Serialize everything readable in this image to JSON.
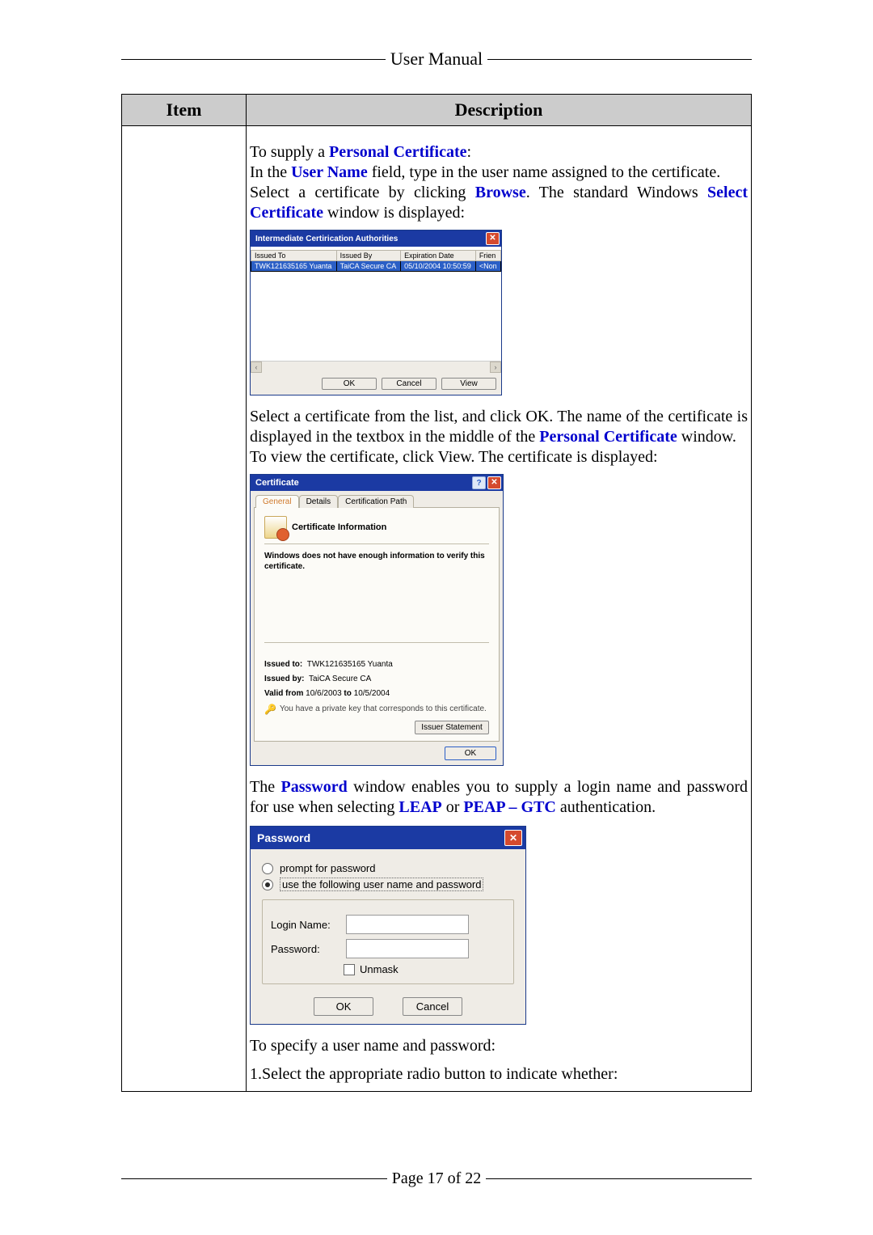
{
  "header": {
    "user_manual": "User Manual"
  },
  "table": {
    "item_header": "Item",
    "desc_header": "Description"
  },
  "content": {
    "supply_prefix": "To supply a ",
    "supply_bold": "Personal Certificate",
    "supply_suffix": ":",
    "username_prefix": "In the ",
    "username_bold": "User Name",
    "username_suffix": " field, type in the user name assigned to the certificate.",
    "select_prefix": "Select a certificate by clicking ",
    "select_browse": "Browse",
    "select_mid": ". The standard Windows ",
    "select_bold": "Select Certificate",
    "select_suffix": " window is displayed:",
    "after_list_prefix": "Select a certificate from the list, and click OK. The name of the certificate is displayed in the textbox in the middle of the ",
    "after_list_bold": "Personal Certificate",
    "after_list_suffix": " window.",
    "view_line": "To view the certificate, click View. The certificate is displayed:",
    "pw_prefix": "The ",
    "pw_bold": "Password",
    "pw_mid": " window enables you to supply a login name and password for use when selecting ",
    "pw_leap": "LEAP",
    "pw_or": " or ",
    "pw_peap": "PEAP – GTC",
    "pw_suffix": " authentication.",
    "spec_line": "To specify a user name and password:",
    "step1": "1.Select the appropriate radio button to indicate whether:"
  },
  "dlg1": {
    "title": "Intermediate Certirication Authorities",
    "col_issued_to": "Issued To",
    "col_issued_by": "Issued By",
    "col_exp": "Expiration Date",
    "col_friendly": "Frien",
    "row_issued_to": "TWK121635165 Yuanta",
    "row_issued_by": "TaiCA Secure CA",
    "row_exp": "05/10/2004 10:50:59",
    "row_friendly": "<Non",
    "ok": "OK",
    "cancel": "Cancel",
    "view": "View"
  },
  "dlg2": {
    "title": "Certificate",
    "tab_general": "General",
    "tab_details": "Details",
    "tab_path": "Certification Path",
    "heading": "Certificate Information",
    "msg": "Windows does not have enough information to verify this certificate.",
    "issued_to_lbl": "Issued to:",
    "issued_to_val": "TWK121635165 Yuanta",
    "issued_by_lbl": "Issued by:",
    "issued_by_val": "TaiCA Secure CA",
    "valid_lbl": "Valid from",
    "valid_from": "10/6/2003",
    "valid_to_lbl": "to",
    "valid_to": "10/5/2004",
    "key_note": "You have a private key that corresponds to this certificate.",
    "issuer_btn": "Issuer Statement",
    "ok": "OK"
  },
  "dlg3": {
    "title": "Password",
    "radio_prompt": "prompt for password",
    "radio_use": "use the following user name and password",
    "login_lbl": "Login Name:",
    "password_lbl": "Password:",
    "unmask": "Unmask",
    "ok": "OK",
    "cancel": "Cancel"
  },
  "footer": {
    "page": "Page 17 of 22"
  }
}
